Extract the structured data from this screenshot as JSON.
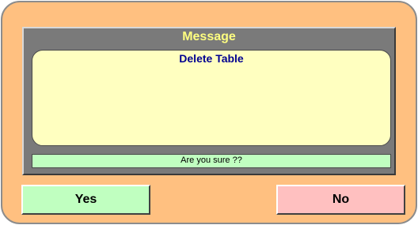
{
  "dialog": {
    "title": "Message",
    "message": "Delete Table",
    "prompt": "Are you sure ??",
    "yes_label": "Yes",
    "no_label": "No"
  },
  "colors": {
    "frame_background": "#ffc080",
    "panel_background": "#7a7a7a",
    "title_text": "#ffff80",
    "message_background": "#ffffc0",
    "message_text": "#000090",
    "prompt_background": "#c0ffc0",
    "yes_button": "#c0ffc0",
    "no_button": "#ffc0c0"
  }
}
